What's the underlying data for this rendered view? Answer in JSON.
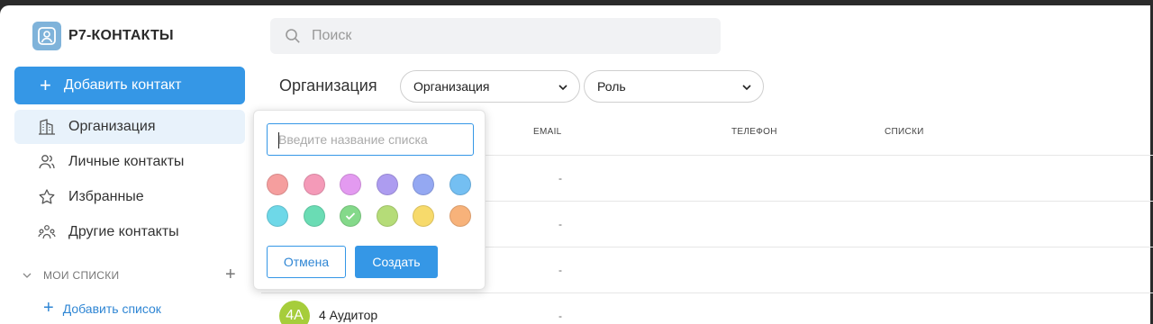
{
  "app": {
    "title": "Р7-КОНТАКТЫ",
    "logo_icon": "contact-card-icon"
  },
  "sidebar": {
    "add_contact_label": "Добавить контакт",
    "items": [
      {
        "label": "Организация",
        "icon": "building-icon",
        "active": true
      },
      {
        "label": "Личные контакты",
        "icon": "people-icon",
        "active": false
      },
      {
        "label": "Избранные",
        "icon": "star-icon",
        "active": false
      },
      {
        "label": "Другие контакты",
        "icon": "group-icon",
        "active": false
      }
    ],
    "lists_header": "МОИ СПИСКИ",
    "add_list_label": "Добавить список"
  },
  "search": {
    "placeholder": "Поиск"
  },
  "main": {
    "title": "Организация",
    "filters": [
      {
        "value": "Организация"
      },
      {
        "value": "Роль"
      }
    ],
    "columns": [
      "EMAIL",
      "ТЕЛЕФОН",
      "СПИСКИ"
    ],
    "rows": [
      {
        "email": "-"
      },
      {
        "email": "-"
      },
      {
        "email": "-"
      },
      {
        "initials": "4А",
        "name": "4 Аудитор",
        "email": "-",
        "avatar_color": "#a6cd3b"
      }
    ]
  },
  "popup": {
    "input_placeholder": "Введите название списка",
    "colors": [
      "#f59e9e",
      "#f49ab8",
      "#e39af0",
      "#ad9cf0",
      "#94a8f2",
      "#74bff2",
      "#6ed8e8",
      "#6adcb4",
      "#84d98a",
      "#b5dc78",
      "#f7da6b",
      "#f7b27a"
    ],
    "selected_color_index": 8,
    "cancel_label": "Отмена",
    "create_label": "Создать"
  },
  "colors": {
    "accent": "#3597e6",
    "active_bg": "#e8f2fb"
  }
}
